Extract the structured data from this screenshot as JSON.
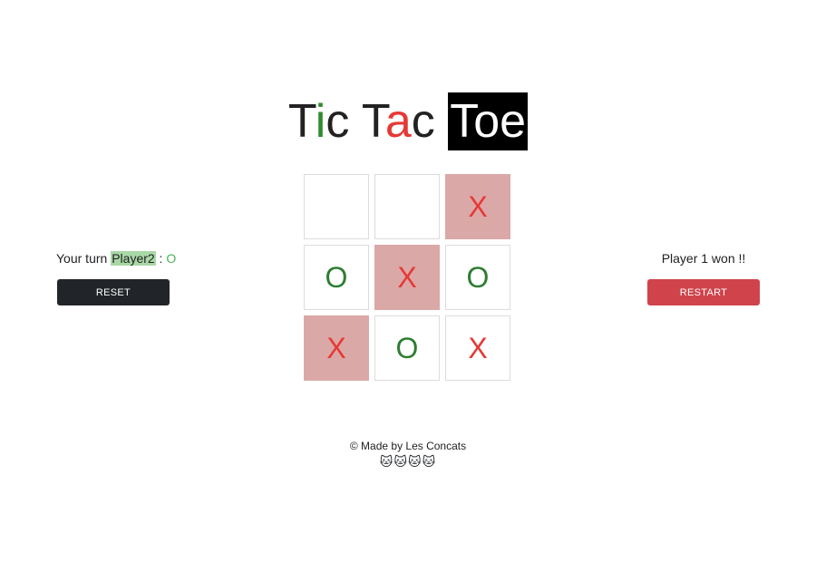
{
  "title": {
    "t": "T",
    "i": "i",
    "c": "c ",
    "t2": "T",
    "a": "a",
    "c2": "c ",
    "toe": "Toe"
  },
  "left": {
    "turn_prefix": "Your turn ",
    "player": "Player2",
    "separator": " : ",
    "mark": "O",
    "reset_label": "RESET"
  },
  "right": {
    "status": "Player 1 won !!",
    "restart_label": "RESTART"
  },
  "board": {
    "cells": [
      "",
      "",
      "X",
      "O",
      "X",
      "O",
      "X",
      "O",
      "X"
    ],
    "winning_cells": [
      2,
      4,
      6
    ]
  },
  "footer": {
    "credit": "© Made by Les Concats",
    "cats": "🐱🐱🐱🐱"
  },
  "colors": {
    "x": "#e53935",
    "o": "#2e7d32",
    "win_bg": "#dba8a8",
    "restart": "#d0434a",
    "reset": "#212529"
  }
}
